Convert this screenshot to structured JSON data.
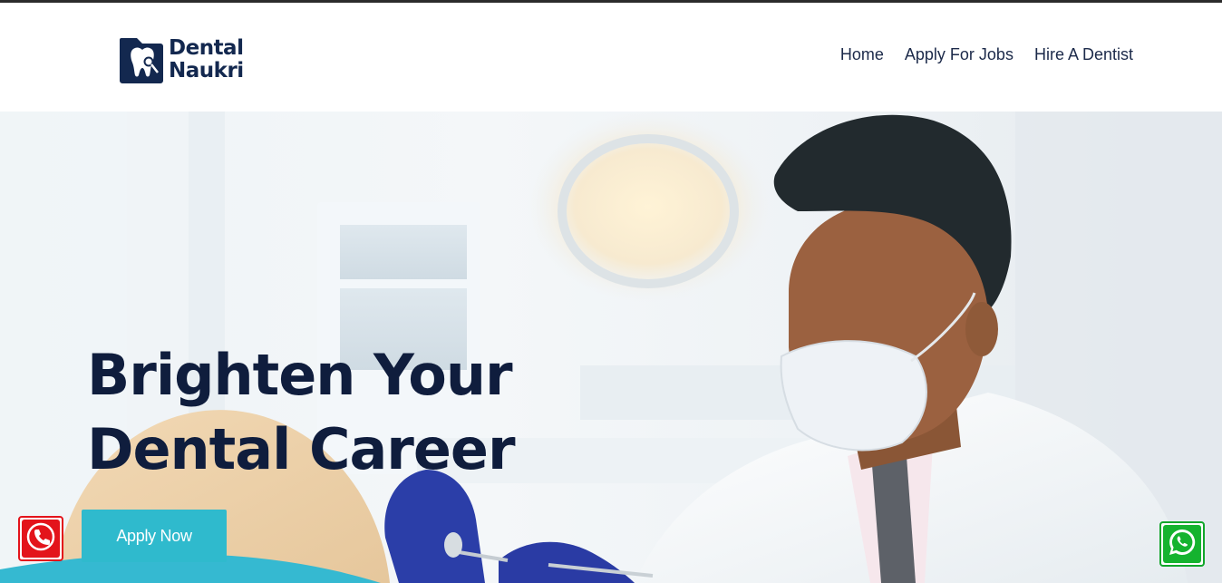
{
  "brand": {
    "name_line1": "Dental",
    "name_line2": "Naukri",
    "color": "#13284f"
  },
  "nav": {
    "items": [
      {
        "label": "Home"
      },
      {
        "label": "Apply For Jobs"
      },
      {
        "label": "Hire A Dentist"
      }
    ]
  },
  "hero": {
    "title_line1": "Brighten Your",
    "title_line2": "Dental Career",
    "cta_label": "Apply Now",
    "cta_color": "#2fbacd",
    "background_image": "dentist with face mask examining a patient in a clinic"
  },
  "floating": {
    "call_icon": "phone-icon",
    "call_color": "#e3141b",
    "whatsapp_icon": "whatsapp-icon",
    "whatsapp_color": "#15b32f"
  }
}
